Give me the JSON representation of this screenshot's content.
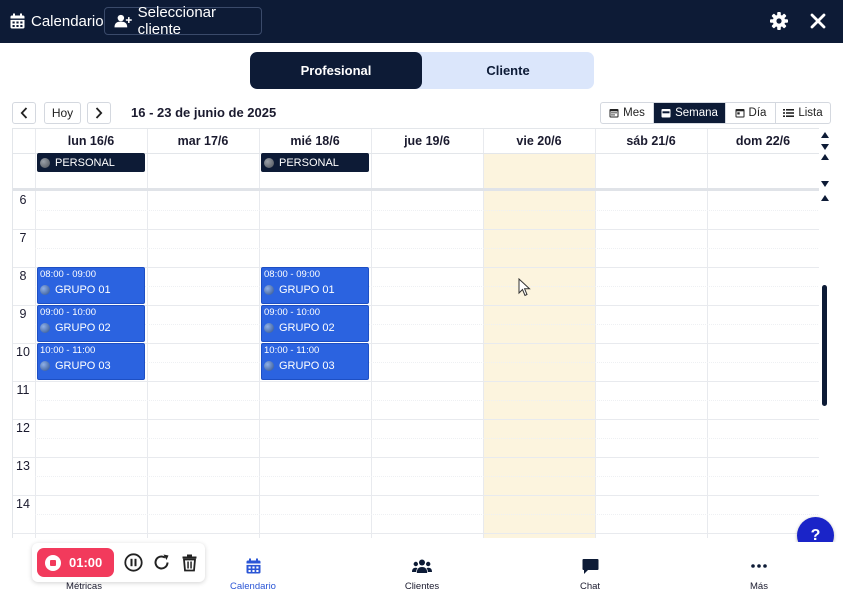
{
  "topbar": {
    "calendar_label": "Calendario",
    "select_client_label": "Seleccionar cliente"
  },
  "segment": {
    "professional": "Profesional",
    "client": "Cliente"
  },
  "toolbar": {
    "today": "Hoy",
    "range": "16 - 23 de junio de 2025",
    "views": [
      "Mes",
      "Semana",
      "Día",
      "Lista"
    ],
    "active_view": "Semana"
  },
  "days": [
    "lun 16/6",
    "mar 17/6",
    "mié 18/6",
    "jue 19/6",
    "vie 20/6",
    "sáb 21/6",
    "dom 22/6"
  ],
  "hours": [
    "6",
    "7",
    "8",
    "9",
    "10",
    "11",
    "12",
    "13",
    "14"
  ],
  "allday_events": [
    {
      "label": "PERSONAL"
    },
    {
      "label": "PERSONAL"
    }
  ],
  "events": [
    {
      "time": "08:00 - 09:00",
      "title": "GRUPO 01"
    },
    {
      "time": "09:00 - 10:00",
      "title": "GRUPO 02"
    },
    {
      "time": "10:00 - 11:00",
      "title": "GRUPO 03"
    },
    {
      "time": "08:00 - 09:00",
      "title": "GRUPO 01"
    },
    {
      "time": "09:00 - 10:00",
      "title": "GRUPO 02"
    },
    {
      "time": "10:00 - 11:00",
      "title": "GRUPO 03"
    }
  ],
  "timer": {
    "value": "01:00"
  },
  "help": "?",
  "nav": {
    "metrics": "Métricas",
    "calendar": "Calendario",
    "clients": "Clientes",
    "chat": "Chat",
    "more": "Más"
  },
  "colors": {
    "navy": "#0d1b36",
    "event_blue": "#2b63e0",
    "today_highlight": "#fcf4de",
    "timer_red": "#f23a5c",
    "help_blue": "#1a24c8"
  }
}
